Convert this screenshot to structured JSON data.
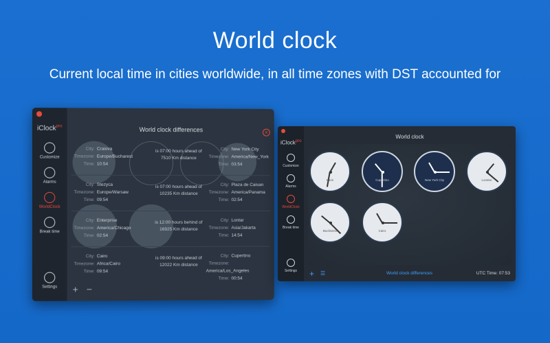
{
  "hero": {
    "title": "World clock",
    "subtitle": "Current local time in cities worldwide, in all time zones with DST accounted for"
  },
  "left_window": {
    "logo": "iClock",
    "logo_badge": "pro",
    "title": "World clock differences",
    "sidebar": [
      {
        "label": "Customize",
        "icon": "brush-icon"
      },
      {
        "label": "Alarms",
        "icon": "bell-icon"
      },
      {
        "label": "WorldClock",
        "icon": "globe-icon",
        "active": true
      },
      {
        "label": "Break time",
        "icon": "stopwatch-icon"
      },
      {
        "label": "Settings",
        "icon": "gear-icon"
      }
    ],
    "keys": {
      "city": "City:",
      "timezone": "Timezone:",
      "time": "Time:"
    },
    "rows": [
      {
        "l_city": "Craiova",
        "l_tz": "Europe/Bucharest",
        "l_time": "10:54",
        "mid1": "is 07:00 hours ahead of",
        "mid2": "7510 Km distance",
        "r_city": "New York City",
        "r_tz": "America/New_York",
        "r_time": "03:54"
      },
      {
        "l_city": "Stezyca",
        "l_tz": "Europe/Warsaw",
        "l_time": "09:54",
        "mid1": "is 07:00 hours ahead of",
        "mid2": "10235 Km distance",
        "r_city": "Plaza de Caisan",
        "r_tz": "America/Panama",
        "r_time": "02:54"
      },
      {
        "l_city": "Enterprise",
        "l_tz": "America/Chicago",
        "l_time": "02:54",
        "mid1": "is 12:00 hours behind of",
        "mid2": "16925 Km distance",
        "r_city": "Lontar",
        "r_tz": "Asia/Jakarta",
        "r_time": "14:54"
      },
      {
        "l_city": "Cairo",
        "l_tz": "Africa/Cairo",
        "l_time": "09:54",
        "mid1": "is 09:00 hours ahead of",
        "mid2": "12022 Km distance",
        "r_city": "Cupertino",
        "r_tz": "America/Los_Angeles",
        "r_time": "00:54"
      }
    ],
    "footer_plus": "+",
    "footer_minus": "−"
  },
  "right_window": {
    "logo": "iClock",
    "logo_badge": "pro",
    "title": "World clock",
    "sidebar": [
      {
        "label": "Customize",
        "icon": "brush-icon"
      },
      {
        "label": "Alarms",
        "icon": "bell-icon"
      },
      {
        "label": "WorldClock",
        "icon": "globe-icon",
        "active": true
      },
      {
        "label": "Break time",
        "icon": "stopwatch-icon"
      },
      {
        "label": "Settings",
        "icon": "gear-icon"
      }
    ],
    "clocks": [
      {
        "name": "Paris",
        "style": "light",
        "hour_deg": -60,
        "min_deg": 100
      },
      {
        "name": "Cupertino",
        "style": "dark",
        "hour_deg": -130,
        "min_deg": 90
      },
      {
        "name": "New York City",
        "style": "dark",
        "hour_deg": -120,
        "min_deg": 0
      },
      {
        "name": "London",
        "style": "light",
        "hour_deg": -50,
        "min_deg": 40
      },
      {
        "name": "Bucharest",
        "style": "light",
        "hour_deg": -140,
        "min_deg": 45
      },
      {
        "name": "Cairo",
        "style": "light",
        "hour_deg": -120,
        "min_deg": 0
      }
    ],
    "footer_link": "World clock differences",
    "utc_label": "UTC Time: 07:53",
    "footer_plus": "+",
    "footer_list": "☰"
  },
  "colors": {
    "accent": "#e84b3c",
    "bg": "#1a6fd0",
    "link": "#3fa0ff"
  }
}
